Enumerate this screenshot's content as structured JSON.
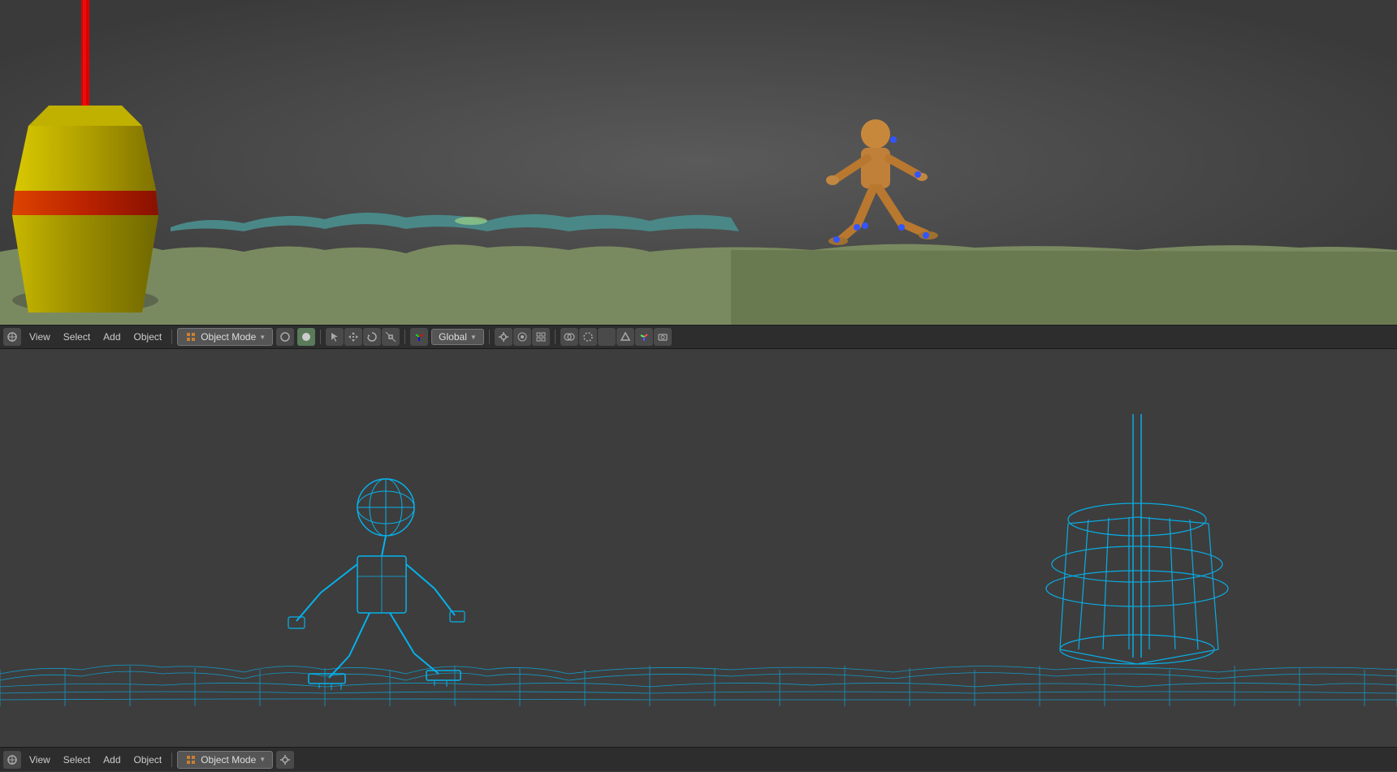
{
  "viewports": {
    "top": {
      "corner_num": "1",
      "background_color": "#4a4a4a"
    },
    "bottom": {
      "corner_num": "1",
      "background_color": "#3d3d3d"
    }
  },
  "toolbar": {
    "items": [
      "View",
      "Select",
      "Add",
      "Object"
    ],
    "mode": "Object Mode",
    "transform": "Global",
    "icons": [
      "cursor",
      "move",
      "rotate",
      "scale",
      "transform"
    ],
    "snapping": "enabled"
  },
  "bottom_toolbar": {
    "items": [
      "View",
      "Select",
      "Add",
      "Object"
    ]
  },
  "colors": {
    "toolbar_bg": "#2d2d2d",
    "viewport_bg": "#4a4a4a",
    "viewport2_bg": "#3d3d3d",
    "text": "#cccccc",
    "active": "#5a8a5a",
    "buoy_yellow": "#c8b400",
    "buoy_red": "#cc3300",
    "wire_color": "#00bfff",
    "character_color": "#c8883c"
  }
}
